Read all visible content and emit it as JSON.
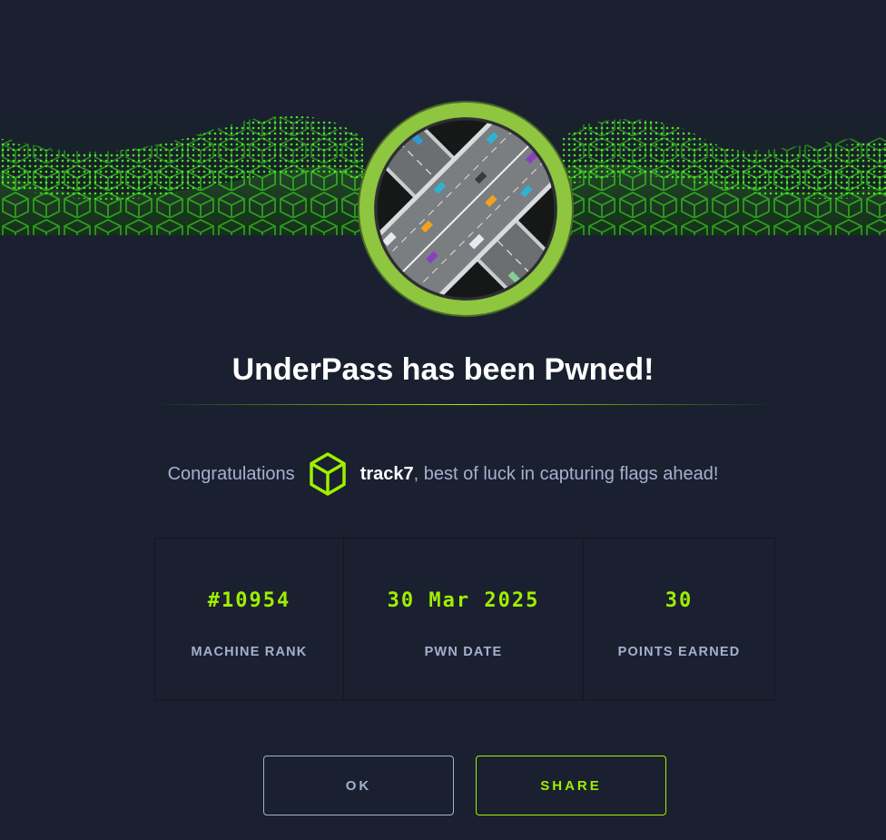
{
  "dialog": {
    "title": "UnderPass has been Pwned!",
    "congrats_lead": "Congratulations",
    "username": "track7",
    "congrats_tail": ", best of luck in capturing flags ahead!"
  },
  "stats": [
    {
      "value": "#10954",
      "label": "MACHINE RANK"
    },
    {
      "value": "30 Mar 2025",
      "label": "PWN DATE"
    },
    {
      "value": "30",
      "label": "POINTS EARNED"
    }
  ],
  "buttons": {
    "ok_label": "OK",
    "share_label": "SHARE"
  },
  "colors": {
    "background": "#1a2030",
    "accent": "#9fef00",
    "muted_text": "#a4b1cd"
  },
  "icons": {
    "machine_avatar": "highway-underpass-image",
    "user_badge": "cube-icon"
  }
}
